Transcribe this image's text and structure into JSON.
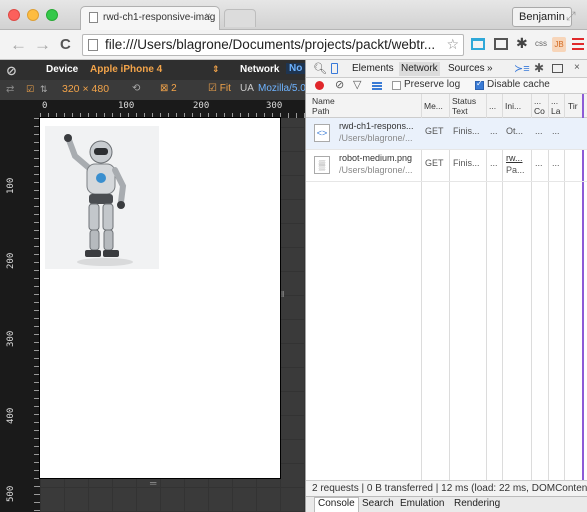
{
  "browser": {
    "tab_title": "rwd-ch1-responsive-imag",
    "tab_close": "×",
    "profile_name": "Benjamin",
    "address": "file:///Users/blagrone/Documents/projects/packt/webtr...",
    "nav": {
      "back": "←",
      "forward": "→",
      "reload": "C",
      "star": "☆"
    },
    "ext_css_label": "css",
    "ext_jb_label": "JB"
  },
  "emulation": {
    "device_label": "Device",
    "device_value": "Apple iPhone 4",
    "network_label": "Network",
    "network_value": "No",
    "width": "320",
    "times": "×",
    "height": "480",
    "dpr": "2",
    "fit_label": "Fit",
    "ua_label": "UA",
    "ua_value": "Mozilla/5.0"
  },
  "rulers": {
    "top": [
      "0",
      "100",
      "200",
      "300"
    ],
    "left": [
      "100",
      "200",
      "300",
      "400",
      "500"
    ]
  },
  "devtools": {
    "tabs": [
      "Elements",
      "Network",
      "Sources",
      "»"
    ],
    "active_tab": "Network",
    "preserve_log": "Preserve log",
    "disable_cache": "Disable cache",
    "columns": {
      "name": "Name",
      "path": "Path",
      "method": "Me...",
      "status": "Status",
      "status_sub": "Text",
      "type": "...",
      "initiator": "Ini...",
      "size": "...",
      "size_sub": "Co",
      "time": "...",
      "time_sub": "La",
      "timeline": "Tir"
    },
    "requests": [
      {
        "icon": "<>",
        "name": "rwd-ch1-respons...",
        "path": "/Users/blagrone/...",
        "method": "GET",
        "status": "Finis...",
        "type": "...",
        "initiator": "Ot...",
        "size": "...",
        "time": "..."
      },
      {
        "icon": "▒",
        "name": "robot-medium.png",
        "path": "/Users/blagrone/...",
        "method": "GET",
        "status": "Finis...",
        "type": "...",
        "initiator": "rw...",
        "initiator2": "Pa...",
        "size": "...",
        "time": "..."
      }
    ],
    "status_bar": "2 requests | 0 B transferred | 12 ms (load: 22 ms, DOMConten...",
    "drawer_tabs": [
      "Console",
      "Search",
      "Emulation",
      "Rendering"
    ]
  }
}
